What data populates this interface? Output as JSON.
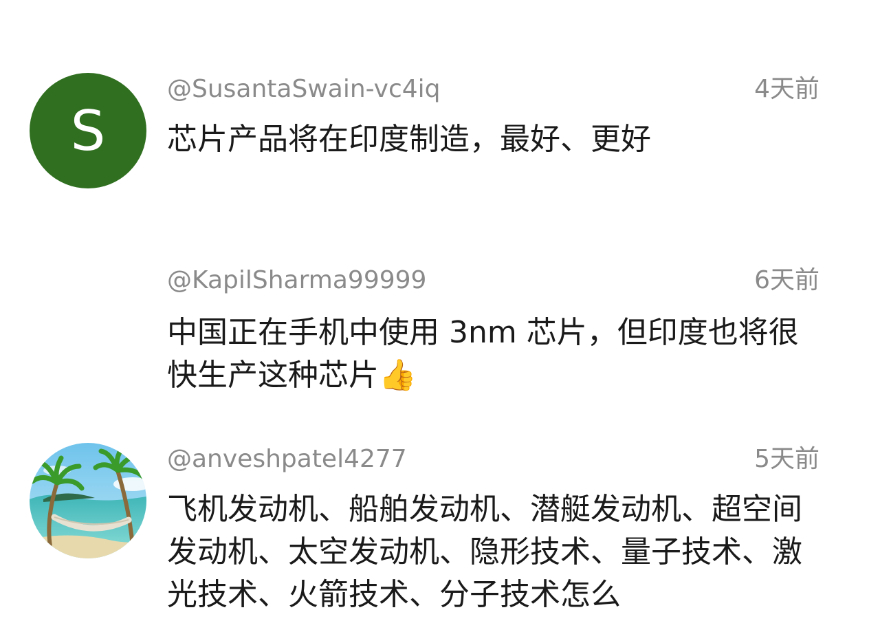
{
  "comments": [
    {
      "avatar_letter": "S",
      "avatar_color": "#2f6f1f",
      "handle": "@SusantaSwain-vc4iq",
      "time": "4天前",
      "text": "芯片产品将在印度制造，最好、更好"
    },
    {
      "handle": "@KapilSharma99999",
      "time": "6天前",
      "text": "中国正在手机中使用 3nm 芯片，但印度也将很快生产这种芯片👍"
    },
    {
      "avatar_icon": "beach-hammock-avatar-icon",
      "handle": "@anveshpatel4277",
      "time": "5天前",
      "text": "飞机发动机、船舶发动机、潜艇发动机、超空间发动机、太空发动机、隐形技术、量子技术、激光技术、火箭技术、分子技术怎么"
    }
  ]
}
